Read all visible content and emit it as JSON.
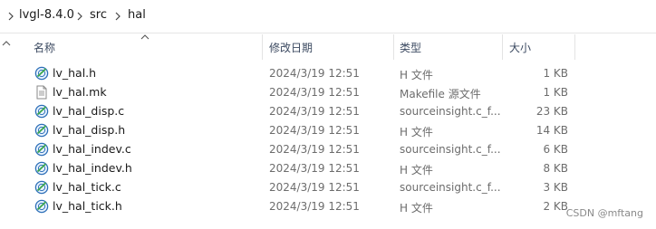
{
  "breadcrumb": {
    "items": [
      "lvgl-8.4.0",
      "src",
      "hal"
    ]
  },
  "columns": {
    "name": "名称",
    "date": "修改日期",
    "type": "类型",
    "size": "大小"
  },
  "icons": {
    "source": "sourceinsight-file-icon",
    "plain": "text-file-icon"
  },
  "files": [
    {
      "name": "lv_hal.h",
      "date": "2024/3/19 12:51",
      "type": "H 文件",
      "size": "1 KB",
      "icon": "sourceinsight-file-icon"
    },
    {
      "name": "lv_hal.mk",
      "date": "2024/3/19 12:51",
      "type": "Makefile 源文件",
      "size": "1 KB",
      "icon": "text-file-icon"
    },
    {
      "name": "lv_hal_disp.c",
      "date": "2024/3/19 12:51",
      "type": "sourceinsight.c_f...",
      "size": "23 KB",
      "icon": "sourceinsight-file-icon"
    },
    {
      "name": "lv_hal_disp.h",
      "date": "2024/3/19 12:51",
      "type": "H 文件",
      "size": "14 KB",
      "icon": "sourceinsight-file-icon"
    },
    {
      "name": "lv_hal_indev.c",
      "date": "2024/3/19 12:51",
      "type": "sourceinsight.c_f...",
      "size": "6 KB",
      "icon": "sourceinsight-file-icon"
    },
    {
      "name": "lv_hal_indev.h",
      "date": "2024/3/19 12:51",
      "type": "H 文件",
      "size": "8 KB",
      "icon": "sourceinsight-file-icon"
    },
    {
      "name": "lv_hal_tick.c",
      "date": "2024/3/19 12:51",
      "type": "sourceinsight.c_f...",
      "size": "3 KB",
      "icon": "sourceinsight-file-icon"
    },
    {
      "name": "lv_hal_tick.h",
      "date": "2024/3/19 12:51",
      "type": "H 文件",
      "size": "2 KB",
      "icon": "sourceinsight-file-icon"
    }
  ],
  "watermark": "CSDN @mftang"
}
